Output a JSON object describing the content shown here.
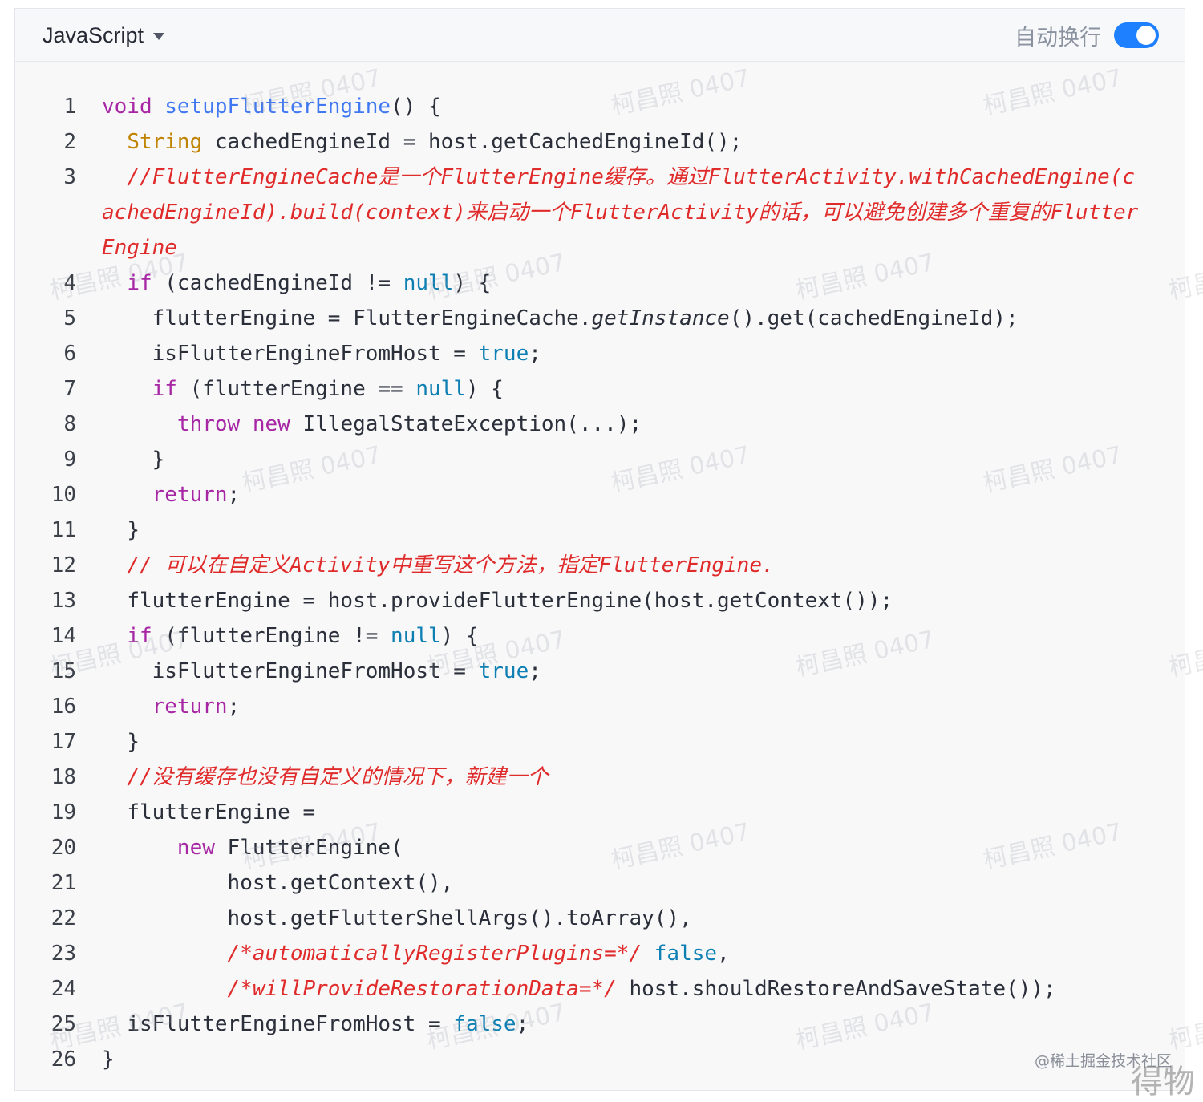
{
  "header": {
    "language": "JavaScript",
    "wrap_label": "自动换行",
    "wrap_enabled": true
  },
  "code_lines": [
    {
      "n": "1",
      "tokens": [
        {
          "t": "void",
          "c": "kw"
        },
        {
          "t": " "
        },
        {
          "t": "setupFlutterEngine",
          "c": "fn"
        },
        {
          "t": "() {"
        }
      ]
    },
    {
      "n": "2",
      "tokens": [
        {
          "t": "  "
        },
        {
          "t": "String",
          "c": "ty"
        },
        {
          "t": " cachedEngineId = host.getCachedEngineId();"
        }
      ]
    },
    {
      "n": "3",
      "tokens": [
        {
          "t": "  "
        },
        {
          "t": "//FlutterEngineCache是一个FlutterEngine缓存。通过FlutterActivity.withCachedEngine(cachedEngineId).build(context)来启动一个FlutterActivity的话，可以避免创建多个重复的FlutterEngine",
          "c": "cm"
        }
      ]
    },
    {
      "n": "4",
      "tokens": [
        {
          "t": "  "
        },
        {
          "t": "if",
          "c": "kw"
        },
        {
          "t": " (cachedEngineId != "
        },
        {
          "t": "null",
          "c": "lit"
        },
        {
          "t": ") {"
        }
      ]
    },
    {
      "n": "5",
      "tokens": [
        {
          "t": "    flutterEngine = FlutterEngineCache."
        },
        {
          "t": "getInstance",
          "c": "it"
        },
        {
          "t": "().get(cachedEngineId);"
        }
      ]
    },
    {
      "n": "6",
      "tokens": [
        {
          "t": "    isFlutterEngineFromHost = "
        },
        {
          "t": "true",
          "c": "lit"
        },
        {
          "t": ";"
        }
      ]
    },
    {
      "n": "7",
      "tokens": [
        {
          "t": "    "
        },
        {
          "t": "if",
          "c": "kw"
        },
        {
          "t": " (flutterEngine == "
        },
        {
          "t": "null",
          "c": "lit"
        },
        {
          "t": ") {"
        }
      ]
    },
    {
      "n": "8",
      "tokens": [
        {
          "t": "      "
        },
        {
          "t": "throw",
          "c": "kw"
        },
        {
          "t": " "
        },
        {
          "t": "new",
          "c": "kw"
        },
        {
          "t": " IllegalStateException(...);"
        }
      ]
    },
    {
      "n": "9",
      "tokens": [
        {
          "t": "    }"
        }
      ]
    },
    {
      "n": "10",
      "tokens": [
        {
          "t": "    "
        },
        {
          "t": "return",
          "c": "kw"
        },
        {
          "t": ";"
        }
      ]
    },
    {
      "n": "11",
      "tokens": [
        {
          "t": "  }"
        }
      ]
    },
    {
      "n": "12",
      "tokens": [
        {
          "t": "  "
        },
        {
          "t": "// 可以在自定义Activity中重写这个方法，指定FlutterEngine.",
          "c": "cm"
        }
      ]
    },
    {
      "n": "13",
      "tokens": [
        {
          "t": "  flutterEngine = host.provideFlutterEngine(host.getContext());"
        }
      ]
    },
    {
      "n": "14",
      "tokens": [
        {
          "t": "  "
        },
        {
          "t": "if",
          "c": "kw"
        },
        {
          "t": " (flutterEngine != "
        },
        {
          "t": "null",
          "c": "lit"
        },
        {
          "t": ") {"
        }
      ]
    },
    {
      "n": "15",
      "tokens": [
        {
          "t": "    isFlutterEngineFromHost = "
        },
        {
          "t": "true",
          "c": "lit"
        },
        {
          "t": ";"
        }
      ]
    },
    {
      "n": "16",
      "tokens": [
        {
          "t": "    "
        },
        {
          "t": "return",
          "c": "kw"
        },
        {
          "t": ";"
        }
      ]
    },
    {
      "n": "17",
      "tokens": [
        {
          "t": "  }"
        }
      ]
    },
    {
      "n": "18",
      "tokens": [
        {
          "t": "  "
        },
        {
          "t": "//没有缓存也没有自定义的情况下，新建一个",
          "c": "cm"
        }
      ]
    },
    {
      "n": "19",
      "tokens": [
        {
          "t": "  flutterEngine ="
        }
      ]
    },
    {
      "n": "20",
      "tokens": [
        {
          "t": "      "
        },
        {
          "t": "new",
          "c": "kw"
        },
        {
          "t": " FlutterEngine("
        }
      ]
    },
    {
      "n": "21",
      "tokens": [
        {
          "t": "          host.getContext(),"
        }
      ]
    },
    {
      "n": "22",
      "tokens": [
        {
          "t": "          host.getFlutterShellArgs().toArray(),"
        }
      ]
    },
    {
      "n": "23",
      "tokens": [
        {
          "t": "          "
        },
        {
          "t": "/*automaticallyRegisterPlugins=*/",
          "c": "cm"
        },
        {
          "t": " "
        },
        {
          "t": "false",
          "c": "lit"
        },
        {
          "t": ","
        }
      ]
    },
    {
      "n": "24",
      "tokens": [
        {
          "t": "          "
        },
        {
          "t": "/*willProvideRestorationData=*/",
          "c": "cm"
        },
        {
          "t": " host.shouldRestoreAndSaveState());"
        }
      ]
    },
    {
      "n": "25",
      "tokens": [
        {
          "t": "  isFlutterEngineFromHost = "
        },
        {
          "t": "false",
          "c": "lit"
        },
        {
          "t": ";"
        }
      ]
    },
    {
      "n": "26",
      "tokens": [
        {
          "t": "}"
        }
      ]
    }
  ],
  "watermark": "柯昌照 0407",
  "credits": {
    "community": "@稀土掘金技术社区",
    "stamp": "得物"
  }
}
